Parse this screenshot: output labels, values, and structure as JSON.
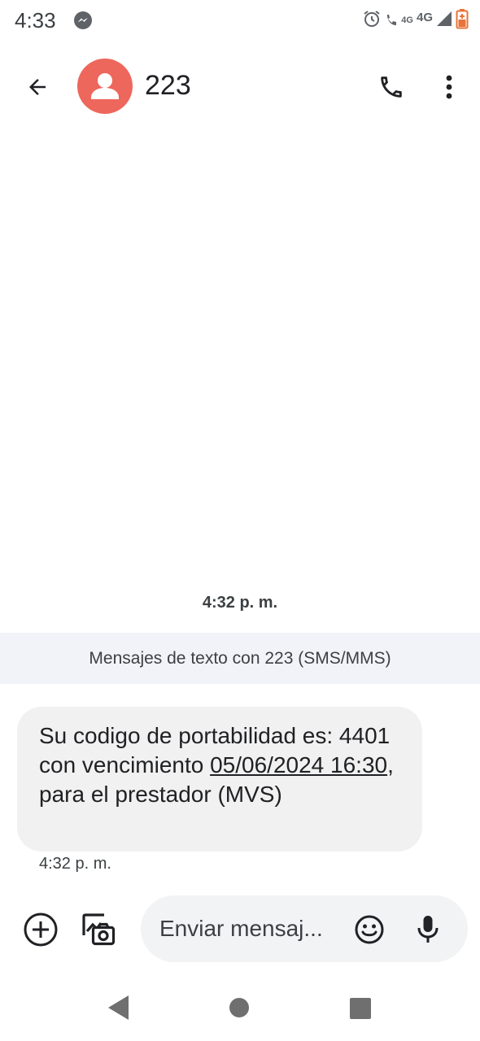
{
  "status_bar": {
    "time": "4:33",
    "network_small": "4G",
    "network": "4G"
  },
  "app_bar": {
    "contact_name": "223",
    "avatar_color": "#ee675c"
  },
  "conversation": {
    "timestamp": "4:32 p. m.",
    "banner": "Mensajes de texto con 223 (SMS/MMS)",
    "messages": [
      {
        "text_before": "Su codigo de portabilidad es: 4401 con vencimiento ",
        "link": "05/06/2024 16:30",
        "text_after": ", para el prestador (MVS)",
        "time": "4:32 p. m."
      }
    ]
  },
  "compose": {
    "placeholder": "Enviar mensaj..."
  },
  "icons": {
    "messenger": "messenger-icon",
    "alarm": "alarm-icon",
    "wifi_call": "phone-4g-icon",
    "signal": "signal-icon",
    "battery": "battery-icon",
    "back": "arrow-back-icon",
    "call": "phone-icon",
    "more": "more-vert-icon",
    "add": "add-circle-icon",
    "gallery": "gallery-camera-icon",
    "emoji": "emoji-icon",
    "mic": "mic-icon"
  },
  "colors": {
    "bubble_bg": "#f1f1f1",
    "banner_bg": "#f1f3f8",
    "compose_bg": "#f1f3f4",
    "battery": "#e8743b"
  }
}
